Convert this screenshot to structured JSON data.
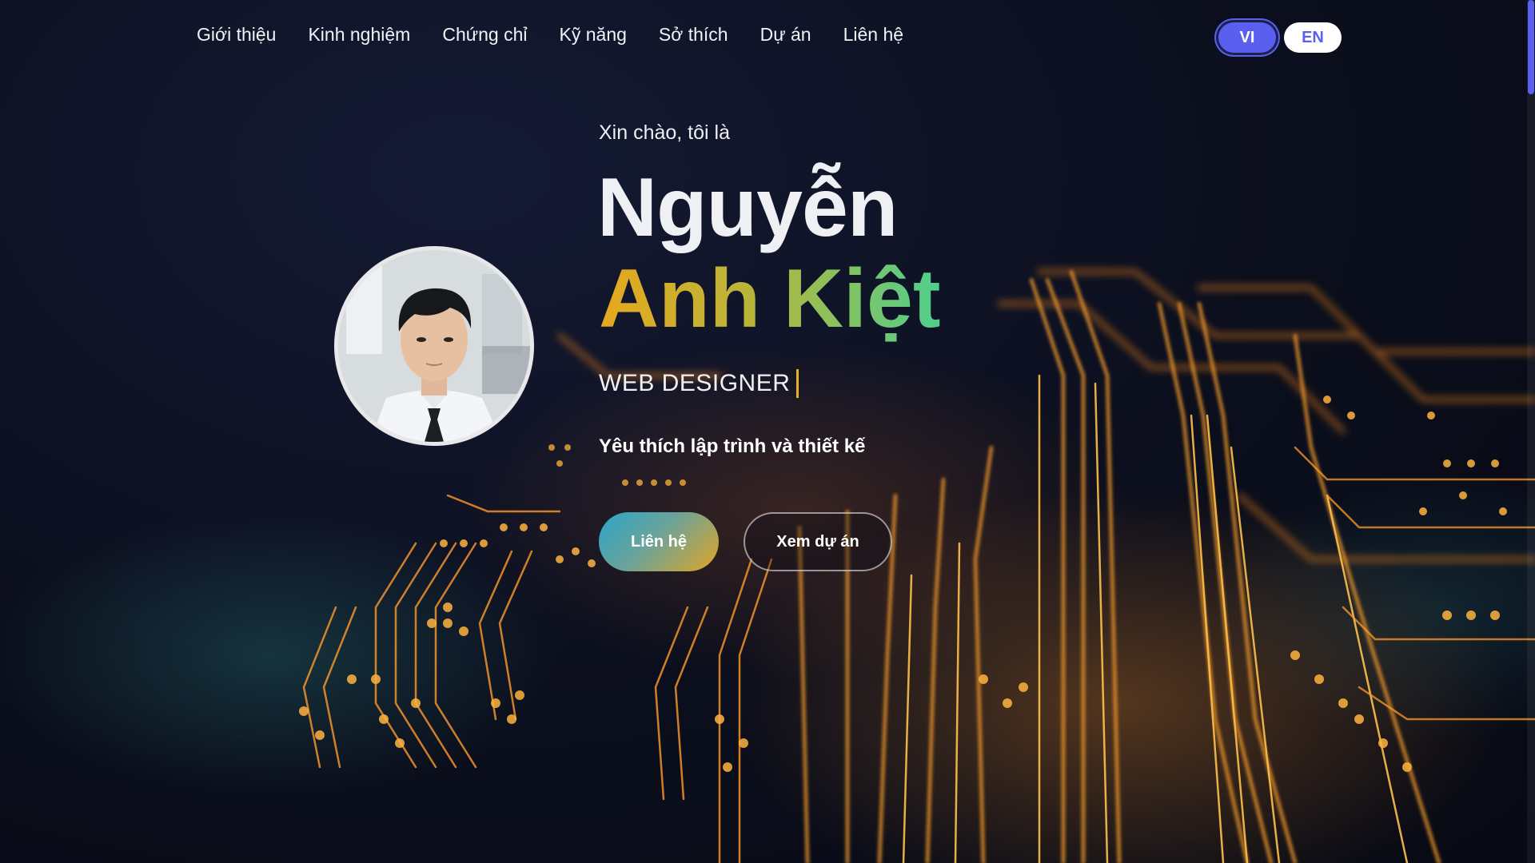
{
  "nav": {
    "items": [
      {
        "label": "Giới thiệu"
      },
      {
        "label": "Kinh nghiệm"
      },
      {
        "label": "Chứng chỉ"
      },
      {
        "label": "Kỹ năng"
      },
      {
        "label": "Sở thích"
      },
      {
        "label": "Dự án"
      },
      {
        "label": "Liên hệ"
      }
    ]
  },
  "language": {
    "vi": "VI",
    "en": "EN",
    "active": "VI"
  },
  "hero": {
    "greeting": "Xin chào, tôi là",
    "name_line1": "Nguyễn",
    "name_line2": "Anh Kiệt",
    "role": "WEB DESIGNER",
    "tagline": "Yêu thích lập trình và thiết kế",
    "contact_button": "Liên hệ",
    "projects_button": "Xem dự án"
  },
  "colors": {
    "accent": "#5b5ff0",
    "gold": "#e6a81e",
    "green": "#4fcf8e",
    "teal": "#2aa6c9",
    "background": "#0c0f1e"
  },
  "icons": {
    "avatar": "profile-photo"
  }
}
